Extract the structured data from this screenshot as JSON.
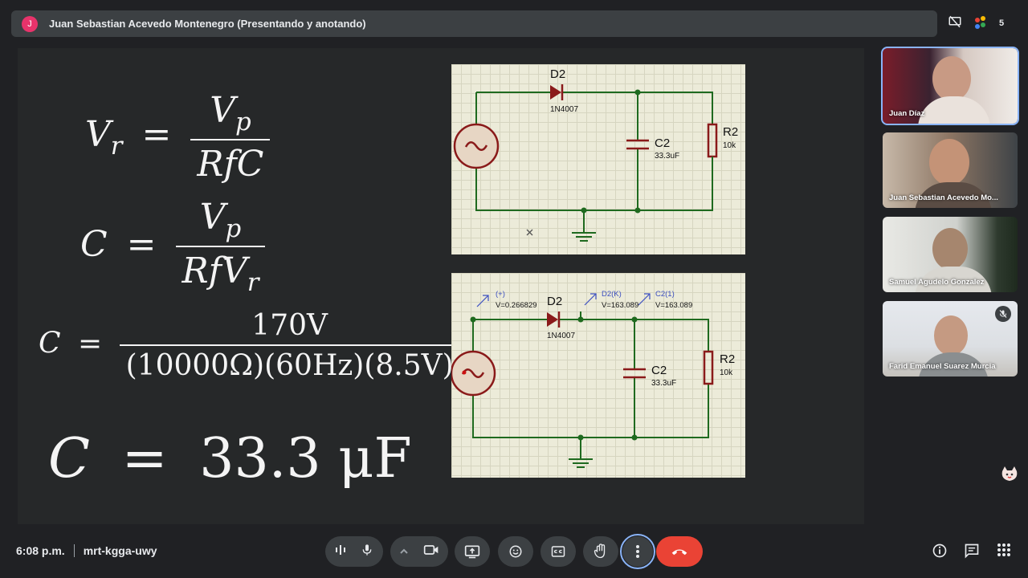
{
  "presenter": {
    "initial": "J",
    "label": "Juan Sebastian Acevedo Montenegro (Presentando y anotando)"
  },
  "participant_count": "5",
  "slide": {
    "eq1": {
      "lhs_main": "V",
      "lhs_sub": "r",
      "num_main": "V",
      "num_sub": "p",
      "den": "RfC"
    },
    "eq2": {
      "lhs": "C",
      "num_main": "V",
      "num_sub": "p",
      "den_main": "RfV",
      "den_sub": "r"
    },
    "eq3": {
      "lhs": "C",
      "num": "170V",
      "den": "(10000Ω)(60Hz)(8.5V)"
    },
    "eq4": {
      "lhs": "C",
      "rhs": "33.3 μF"
    },
    "circuit_top": {
      "diode_name": "D2",
      "diode_model": "1N4007",
      "cap_name": "C2",
      "cap_value": "33.3uF",
      "res_name": "R2",
      "res_value": "10k"
    },
    "circuit_bottom": {
      "diode_name": "D2",
      "diode_model": "1N4007",
      "cap_name": "C2",
      "cap_value": "33.3uF",
      "res_name": "R2",
      "res_value": "10k",
      "probe1_name": "(+)",
      "probe1_value": "V=0.266829",
      "probe2_name": "D2(K)",
      "probe2_value": "V=163.089",
      "probe3_name": "C2(1)",
      "probe3_value": "V=163.089"
    }
  },
  "participants": [
    {
      "name": "Juan Díaz"
    },
    {
      "name": "Juan Sebastian Acevedo Mo..."
    },
    {
      "name": "Samuel Agudelo Gonzalez"
    },
    {
      "name": "Farid Emanuel Suarez Murcia"
    }
  ],
  "meeting": {
    "time": "6:08 p.m.",
    "code": "mrt-kgga-uwy"
  },
  "colors": {
    "background": "#202124",
    "bar": "#3c4043",
    "end_call": "#ea4335",
    "accent": "#8ab4f8",
    "wire": "#1f6a1f",
    "component": "#8a1a1a"
  }
}
